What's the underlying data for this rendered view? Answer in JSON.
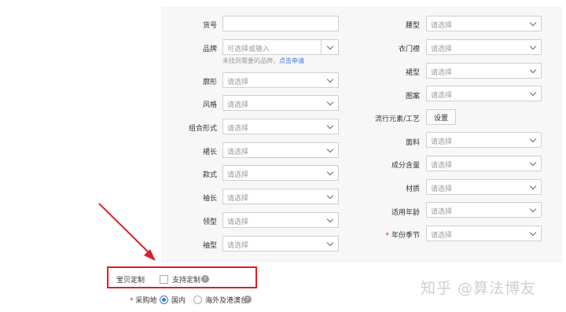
{
  "header_fragment": "",
  "left_column": [
    {
      "label": "货号",
      "type": "input",
      "value": ""
    },
    {
      "label": "品牌",
      "type": "combo",
      "placeholder": "可选择或输入"
    },
    {
      "label": "廓形",
      "type": "select",
      "placeholder": "请选择"
    },
    {
      "label": "风格",
      "type": "select",
      "placeholder": "请选择"
    },
    {
      "label": "组合形式",
      "type": "select",
      "placeholder": "请选择"
    },
    {
      "label": "裙长",
      "type": "select",
      "placeholder": "请选择"
    },
    {
      "label": "款式",
      "type": "select",
      "placeholder": "请选择"
    },
    {
      "label": "袖长",
      "type": "select",
      "placeholder": "请选择"
    },
    {
      "label": "领型",
      "type": "select",
      "placeholder": "请选择"
    },
    {
      "label": "袖型",
      "type": "select",
      "placeholder": "请选择"
    }
  ],
  "brand_hint": {
    "text": "未找到需要的品牌，",
    "link": "点击申请"
  },
  "right_column": [
    {
      "label": "腰型",
      "type": "select",
      "placeholder": "请选择"
    },
    {
      "label": "衣门襟",
      "type": "select",
      "placeholder": "请选择"
    },
    {
      "label": "裙型",
      "type": "select",
      "placeholder": "请选择"
    },
    {
      "label": "图案",
      "type": "select",
      "placeholder": "请选择"
    },
    {
      "label": "流行元素/工艺",
      "type": "button",
      "button_label": "设置"
    },
    {
      "label": "面料",
      "type": "select",
      "placeholder": "请选择"
    },
    {
      "label": "成分含量",
      "type": "select",
      "placeholder": "请选择"
    },
    {
      "label": "材质",
      "type": "select",
      "placeholder": "请选择"
    },
    {
      "label": "适用年龄",
      "type": "select",
      "placeholder": "请选择"
    },
    {
      "label": "年份季节",
      "type": "select",
      "placeholder": "请选择",
      "required": true
    }
  ],
  "customization": {
    "label": "宝贝定制",
    "checkbox_label": "支持定制",
    "checked": false,
    "help_icon": "question-circle-icon"
  },
  "purchase_location": {
    "label": "采购地",
    "required": true,
    "options": [
      {
        "label": "国内",
        "selected": true
      },
      {
        "label": "海外及港澳台",
        "selected": false
      }
    ],
    "help_icon": "question-circle-icon"
  },
  "annotation": {
    "arrow_color": "#d8202a",
    "box_color": "#d8202a"
  },
  "watermark": "知乎 @算法博友"
}
